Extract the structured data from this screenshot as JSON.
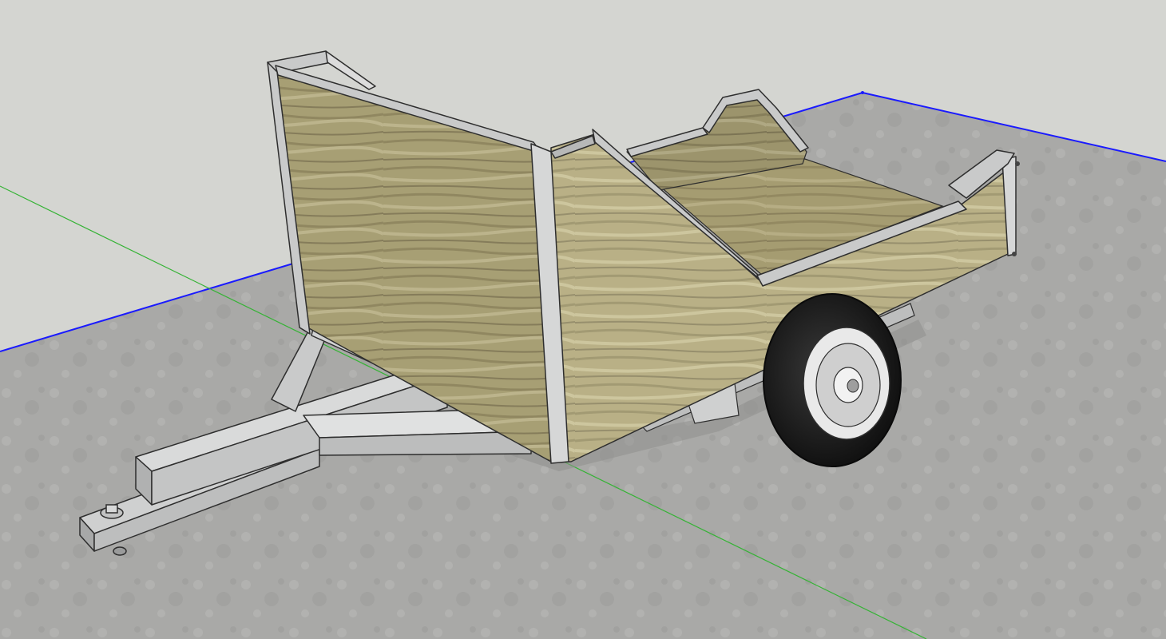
{
  "app": {
    "viewport": {
      "model": "utility-trailer",
      "colors": {
        "sky": "#d4d5d1",
        "ground": "#a8a8a6",
        "axis_red_blue": "#1a1aff",
        "axis_green": "#36b336",
        "wood_light": "#b9b083",
        "wood_dark": "#8a8058",
        "steel": "#c7c8c8",
        "steel_edge": "#2e2e2e",
        "tire": "#141414",
        "rim": "#e4e4e4"
      },
      "icons": [
        "wheel-icon",
        "hitch-icon",
        "axis-icon"
      ]
    }
  }
}
